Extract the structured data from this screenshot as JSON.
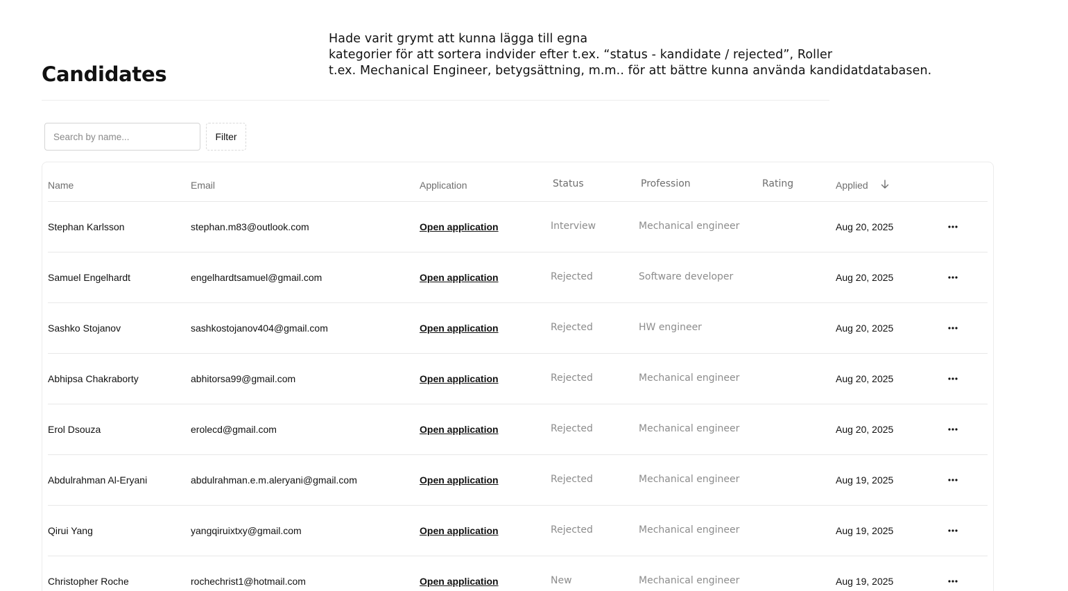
{
  "note": {
    "lines": [
      "Hade varit grymt att kunna lägga till egna",
      "kategorier för att sortera indvider efter t.ex. “status - kandidate / rejected”, Roller",
      "t.ex. Mechanical Engineer, betygsättning, m.m.. för att bättre kunna använda kandidatdatabasen."
    ]
  },
  "page": {
    "title": "Candidates"
  },
  "toolbar": {
    "search_placeholder": "Search by name...",
    "search_value": "",
    "filter_label": "Filter"
  },
  "table": {
    "headers": {
      "name": "Name",
      "email": "Email",
      "application": "Application",
      "status": "Status",
      "profession": "Profession",
      "rating": "Rating",
      "applied": "Applied"
    },
    "sort_icon": "arrow-down-icon",
    "more_icon": "ellipsis-icon",
    "rows": [
      {
        "name": "Stephan Karlsson",
        "email": "stephan.m83@outlook.com",
        "application": "Open application",
        "status": "Interview",
        "profession": "Mechanical engineer",
        "rating": "",
        "applied": "Aug 20, 2025"
      },
      {
        "name": "Samuel Engelhardt",
        "email": "engelhardtsamuel@gmail.com",
        "application": "Open application",
        "status": "Rejected",
        "profession": "Software developer",
        "rating": "",
        "applied": "Aug 20, 2025"
      },
      {
        "name": "Sashko Stojanov",
        "email": "sashkostojanov404@gmail.com",
        "application": "Open application",
        "status": "Rejected",
        "profession": "HW engineer",
        "rating": "",
        "applied": "Aug 20, 2025"
      },
      {
        "name": "Abhipsa Chakraborty",
        "email": "abhitorsa99@gmail.com",
        "application": "Open application",
        "status": "Rejected",
        "profession": "Mechanical engineer",
        "rating": "",
        "applied": "Aug 20, 2025"
      },
      {
        "name": "Erol Dsouza",
        "email": "erolecd@gmail.com",
        "application": "Open application",
        "status": "Rejected",
        "profession": "Mechanical engineer",
        "rating": "",
        "applied": "Aug 20, 2025"
      },
      {
        "name": "Abdulrahman Al-Eryani",
        "email": "abdulrahman.e.m.aleryani@gmail.com",
        "application": "Open application",
        "status": "Rejected",
        "profession": "Mechanical engineer",
        "rating": "",
        "applied": "Aug 19, 2025"
      },
      {
        "name": "Qirui Yang",
        "email": "yangqiruixtxy@gmail.com",
        "application": "Open application",
        "status": "Rejected",
        "profession": "Mechanical engineer",
        "rating": "",
        "applied": "Aug 19, 2025"
      },
      {
        "name": "Christopher Roche",
        "email": "rochechrist1@hotmail.com",
        "application": "Open application",
        "status": "New",
        "profession": "Mechanical engineer",
        "rating": "",
        "applied": "Aug 19, 2025"
      }
    ]
  }
}
